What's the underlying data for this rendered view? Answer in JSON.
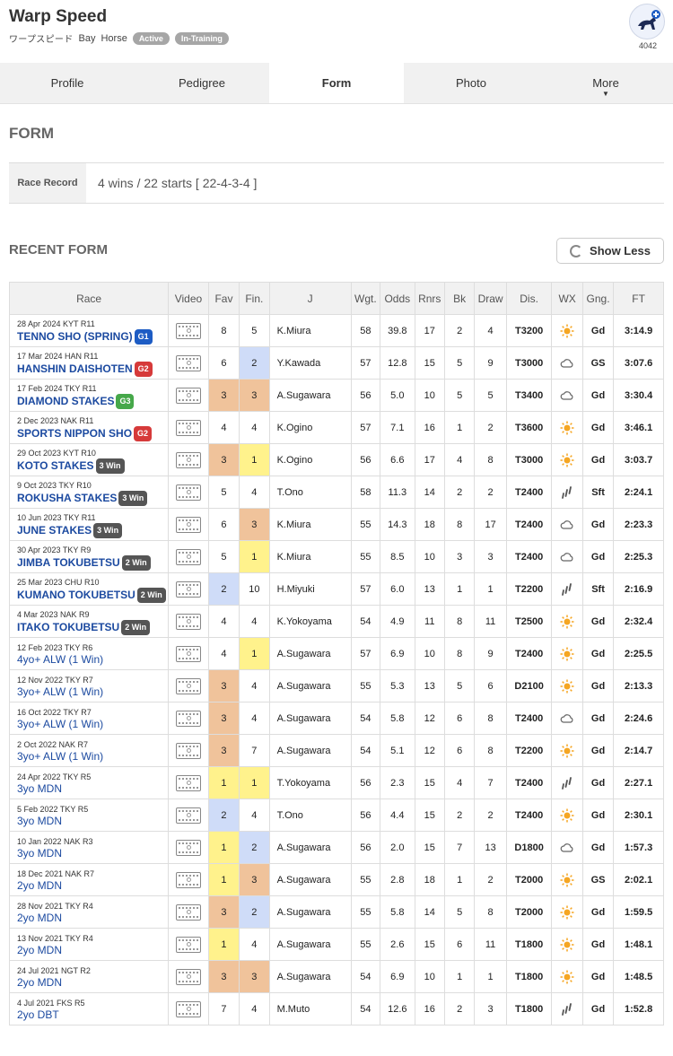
{
  "header": {
    "name": "Warp Speed",
    "name_jp": "ワープスピード",
    "color": "Bay",
    "sex": "Horse",
    "status": "Active",
    "training": "In-Training",
    "logo_number": "4042"
  },
  "tabs": [
    {
      "label": "Profile",
      "active": false
    },
    {
      "label": "Pedigree",
      "active": false
    },
    {
      "label": "Form",
      "active": true
    },
    {
      "label": "Photo",
      "active": false
    },
    {
      "label": "More",
      "active": false
    }
  ],
  "form_title": "FORM",
  "race_record": {
    "label": "Race Record",
    "value": "4 wins / 22 starts [ 22-4-3-4 ]"
  },
  "recent_title": "RECENT FORM",
  "show_less_label": "Show Less",
  "colors": {
    "orange": "#f0c39b",
    "yellow": "#fff28c",
    "blue": "#cfdcf8",
    "race_link": "#1c4aa0"
  },
  "columns": [
    "Race",
    "Video",
    "Fav",
    "Fin.",
    "J",
    "Wgt.",
    "Odds",
    "Rnrs",
    "Bk",
    "Draw",
    "Dis.",
    "WX",
    "Gng.",
    "FT"
  ],
  "rows": [
    {
      "meta": "28 Apr 2024 KYT R11",
      "name": "TENNO SHO (SPRING)",
      "badge": "G1",
      "fav": "8",
      "fin": "5",
      "jockey": "K.Miura",
      "wgt": "58",
      "odds": "39.8",
      "rnrs": "17",
      "bk": "2",
      "draw": "4",
      "dis": "T3200",
      "wx": "sunny-icon",
      "gng": "Gd",
      "ft": "3:14.9"
    },
    {
      "meta": "17 Mar 2024 HAN R11",
      "name": "HANSHIN DAISHOTEN",
      "badge": "G2",
      "fav": "6",
      "fin": "2",
      "jockey": "Y.Kawada",
      "wgt": "57",
      "odds": "12.8",
      "rnrs": "15",
      "bk": "5",
      "draw": "9",
      "dis": "T3000",
      "wx": "cloudy-icon",
      "gng": "GS",
      "ft": "3:07.6"
    },
    {
      "meta": "17 Feb 2024 TKY R11",
      "name": "DIAMOND STAKES",
      "badge": "G3",
      "fav": "3",
      "fin": "3",
      "jockey": "A.Sugawara",
      "wgt": "56",
      "odds": "5.0",
      "rnrs": "10",
      "bk": "5",
      "draw": "5",
      "dis": "T3400",
      "wx": "cloudy-icon",
      "gng": "Gd",
      "ft": "3:30.4"
    },
    {
      "meta": "2 Dec 2023 NAK R11",
      "name": "SPORTS NIPPON SHO",
      "badge": "G2",
      "fav": "4",
      "fin": "4",
      "jockey": "K.Ogino",
      "wgt": "57",
      "odds": "7.1",
      "rnrs": "16",
      "bk": "1",
      "draw": "2",
      "dis": "T3600",
      "wx": "sunny-icon",
      "gng": "Gd",
      "ft": "3:46.1"
    },
    {
      "meta": "29 Oct 2023 KYT R10",
      "name": "KOTO STAKES",
      "badge": "3 Win",
      "fav": "3",
      "fin": "1",
      "jockey": "K.Ogino",
      "wgt": "56",
      "odds": "6.6",
      "rnrs": "17",
      "bk": "4",
      "draw": "8",
      "dis": "T3000",
      "wx": "sunny-icon",
      "gng": "Gd",
      "ft": "3:03.7"
    },
    {
      "meta": "9 Oct 2023 TKY R10",
      "name": "ROKUSHA STAKES",
      "badge": "3 Win",
      "fav": "5",
      "fin": "4",
      "jockey": "T.Ono",
      "wgt": "58",
      "odds": "11.3",
      "rnrs": "14",
      "bk": "2",
      "draw": "2",
      "dis": "T2400",
      "wx": "rain-icon",
      "gng": "Sft",
      "ft": "2:24.1"
    },
    {
      "meta": "10 Jun 2023 TKY R11",
      "name": "JUNE STAKES",
      "badge": "3 Win",
      "fav": "6",
      "fin": "3",
      "jockey": "K.Miura",
      "wgt": "55",
      "odds": "14.3",
      "rnrs": "18",
      "bk": "8",
      "draw": "17",
      "dis": "T2400",
      "wx": "cloudy-icon",
      "gng": "Gd",
      "ft": "2:23.3"
    },
    {
      "meta": "30 Apr 2023 TKY R9",
      "name": "JIMBA TOKUBETSU",
      "badge": "2 Win",
      "fav": "5",
      "fin": "1",
      "jockey": "K.Miura",
      "wgt": "55",
      "odds": "8.5",
      "rnrs": "10",
      "bk": "3",
      "draw": "3",
      "dis": "T2400",
      "wx": "cloudy-icon",
      "gng": "Gd",
      "ft": "2:25.3"
    },
    {
      "meta": "25 Mar 2023 CHU R10",
      "name": "KUMANO TOKUBETSU",
      "badge": "2 Win",
      "fav": "2",
      "fin": "10",
      "jockey": "H.Miyuki",
      "wgt": "57",
      "odds": "6.0",
      "rnrs": "13",
      "bk": "1",
      "draw": "1",
      "dis": "T2200",
      "wx": "rain-icon",
      "gng": "Sft",
      "ft": "2:16.9"
    },
    {
      "meta": "4 Mar 2023 NAK R9",
      "name": "ITAKO TOKUBETSU",
      "badge": "2 Win",
      "fav": "4",
      "fin": "4",
      "jockey": "K.Yokoyama",
      "wgt": "54",
      "odds": "4.9",
      "rnrs": "11",
      "bk": "8",
      "draw": "11",
      "dis": "T2500",
      "wx": "sunny-icon",
      "gng": "Gd",
      "ft": "2:32.4"
    },
    {
      "meta": "12 Feb 2023 TKY R6",
      "name": "4yo+ ALW (1 Win)",
      "badge": "",
      "fav": "4",
      "fin": "1",
      "jockey": "A.Sugawara",
      "wgt": "57",
      "odds": "6.9",
      "rnrs": "10",
      "bk": "8",
      "draw": "9",
      "dis": "T2400",
      "wx": "sunny-icon",
      "gng": "Gd",
      "ft": "2:25.5"
    },
    {
      "meta": "12 Nov 2022 TKY R7",
      "name": "3yo+ ALW (1 Win)",
      "badge": "",
      "fav": "3",
      "fin": "4",
      "jockey": "A.Sugawara",
      "wgt": "55",
      "odds": "5.3",
      "rnrs": "13",
      "bk": "5",
      "draw": "6",
      "dis": "D2100",
      "wx": "sunny-icon",
      "gng": "Gd",
      "ft": "2:13.3"
    },
    {
      "meta": "16 Oct 2022 TKY R7",
      "name": "3yo+ ALW (1 Win)",
      "badge": "",
      "fav": "3",
      "fin": "4",
      "jockey": "A.Sugawara",
      "wgt": "54",
      "odds": "5.8",
      "rnrs": "12",
      "bk": "6",
      "draw": "8",
      "dis": "T2400",
      "wx": "cloudy-icon",
      "gng": "Gd",
      "ft": "2:24.6"
    },
    {
      "meta": "2 Oct 2022 NAK R7",
      "name": "3yo+ ALW (1 Win)",
      "badge": "",
      "fav": "3",
      "fin": "7",
      "jockey": "A.Sugawara",
      "wgt": "54",
      "odds": "5.1",
      "rnrs": "12",
      "bk": "6",
      "draw": "8",
      "dis": "T2200",
      "wx": "sunny-icon",
      "gng": "Gd",
      "ft": "2:14.7"
    },
    {
      "meta": "24 Apr 2022 TKY R5",
      "name": "3yo MDN",
      "badge": "",
      "fav": "1",
      "fin": "1",
      "jockey": "T.Yokoyama",
      "wgt": "56",
      "odds": "2.3",
      "rnrs": "15",
      "bk": "4",
      "draw": "7",
      "dis": "T2400",
      "wx": "rain-icon",
      "gng": "Gd",
      "ft": "2:27.1"
    },
    {
      "meta": "5 Feb 2022 TKY R5",
      "name": "3yo MDN",
      "badge": "",
      "fav": "2",
      "fin": "4",
      "jockey": "T.Ono",
      "wgt": "56",
      "odds": "4.4",
      "rnrs": "15",
      "bk": "2",
      "draw": "2",
      "dis": "T2400",
      "wx": "sunny-icon",
      "gng": "Gd",
      "ft": "2:30.1"
    },
    {
      "meta": "10 Jan 2022 NAK R3",
      "name": "3yo MDN",
      "badge": "",
      "fav": "1",
      "fin": "2",
      "jockey": "A.Sugawara",
      "wgt": "56",
      "odds": "2.0",
      "rnrs": "15",
      "bk": "7",
      "draw": "13",
      "dis": "D1800",
      "wx": "cloudy-icon",
      "gng": "Gd",
      "ft": "1:57.3"
    },
    {
      "meta": "18 Dec 2021 NAK R7",
      "name": "2yo MDN",
      "badge": "",
      "fav": "1",
      "fin": "3",
      "jockey": "A.Sugawara",
      "wgt": "55",
      "odds": "2.8",
      "rnrs": "18",
      "bk": "1",
      "draw": "2",
      "dis": "T2000",
      "wx": "sunny-icon",
      "gng": "GS",
      "ft": "2:02.1"
    },
    {
      "meta": "28 Nov 2021 TKY R4",
      "name": "2yo MDN",
      "badge": "",
      "fav": "3",
      "fin": "2",
      "jockey": "A.Sugawara",
      "wgt": "55",
      "odds": "5.8",
      "rnrs": "14",
      "bk": "5",
      "draw": "8",
      "dis": "T2000",
      "wx": "sunny-icon",
      "gng": "Gd",
      "ft": "1:59.5"
    },
    {
      "meta": "13 Nov 2021 TKY R4",
      "name": "2yo MDN",
      "badge": "",
      "fav": "1",
      "fin": "4",
      "jockey": "A.Sugawara",
      "wgt": "55",
      "odds": "2.6",
      "rnrs": "15",
      "bk": "6",
      "draw": "11",
      "dis": "T1800",
      "wx": "sunny-icon",
      "gng": "Gd",
      "ft": "1:48.1"
    },
    {
      "meta": "24 Jul 2021 NGT R2",
      "name": "2yo MDN",
      "badge": "",
      "fav": "3",
      "fin": "3",
      "jockey": "A.Sugawara",
      "wgt": "54",
      "odds": "6.9",
      "rnrs": "10",
      "bk": "1",
      "draw": "1",
      "dis": "T1800",
      "wx": "sunny-icon",
      "gng": "Gd",
      "ft": "1:48.5"
    },
    {
      "meta": "4 Jul 2021 FKS R5",
      "name": "2yo DBT",
      "badge": "",
      "fav": "7",
      "fin": "4",
      "jockey": "M.Muto",
      "wgt": "54",
      "odds": "12.6",
      "rnrs": "16",
      "bk": "2",
      "draw": "3",
      "dis": "T1800",
      "wx": "rain-icon",
      "gng": "Gd",
      "ft": "1:52.8"
    }
  ]
}
